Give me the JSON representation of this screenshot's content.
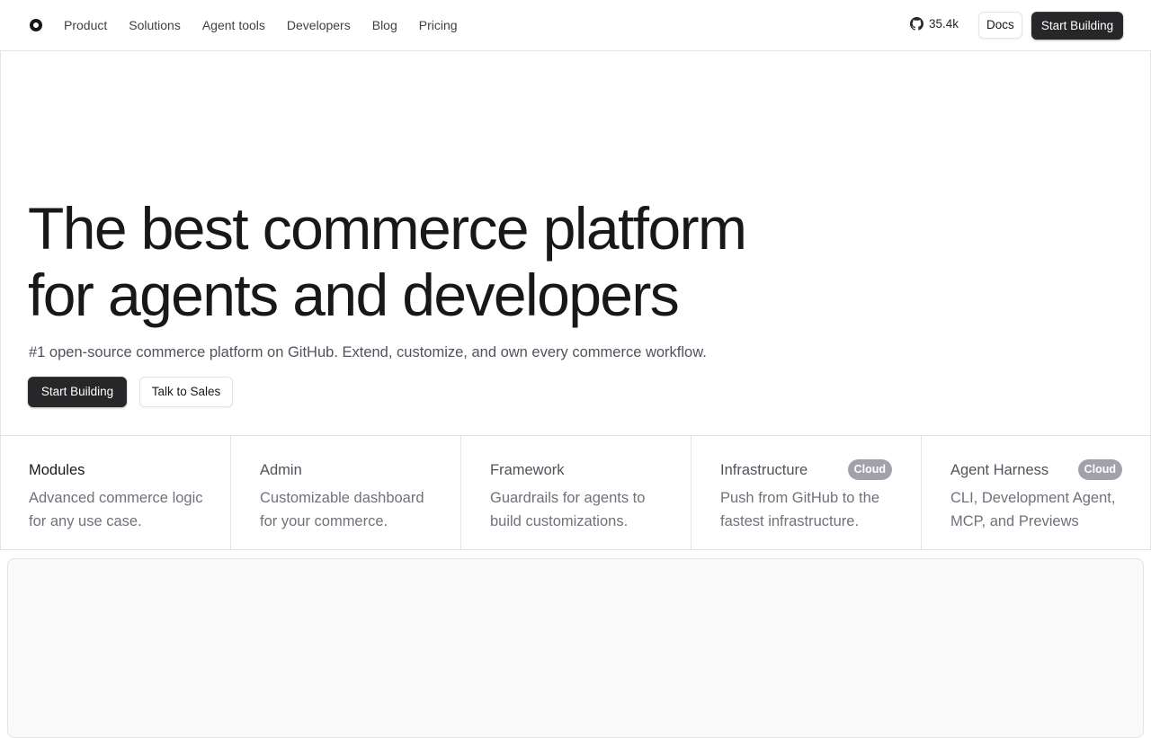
{
  "nav": {
    "links": [
      "Product",
      "Solutions",
      "Agent tools",
      "Developers",
      "Blog",
      "Pricing"
    ],
    "github_stars": "35.4k",
    "docs_label": "Docs",
    "start_label": "Start Building"
  },
  "hero": {
    "title_line1": "The best commerce platform",
    "title_line2": "for agents and developers",
    "subtitle": "#1 open-source commerce platform on GitHub. Extend, customize, and own every commerce workflow.",
    "primary_label": "Start Building",
    "secondary_label": "Talk to Sales"
  },
  "features": [
    {
      "title": "Modules",
      "desc": "Advanced commerce logic for any use case.",
      "badge": ""
    },
    {
      "title": "Admin",
      "desc": "Customizable dashboard for your commerce.",
      "badge": ""
    },
    {
      "title": "Framework",
      "desc": "Guardrails for agents to build customizations.",
      "badge": ""
    },
    {
      "title": "Infrastructure",
      "desc": "Push from GitHub to the fastest infrastructure.",
      "badge": "Cloud"
    },
    {
      "title": "Agent Harness",
      "desc": "CLI, Development Agent, MCP, and Previews",
      "badge": "Cloud"
    }
  ],
  "colors": {
    "primary_button": "#27272a",
    "badge": "#a1a1aa",
    "border": "#e4e4e7"
  }
}
